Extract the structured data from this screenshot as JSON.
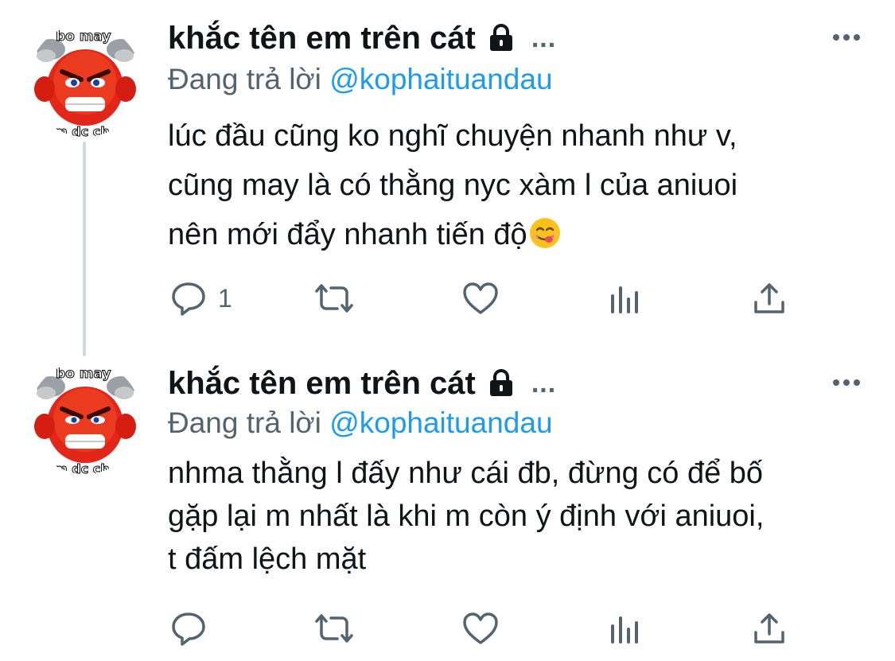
{
  "tweets": [
    {
      "author": "khắc tên em trên cát",
      "ellipsis": "...",
      "reply_prefix": "Đang trả lời",
      "reply_to": "@kophaituandau",
      "text": "lúc đầu cũng ko nghĩ chuyện nhanh như v,\ncũng may là có thằng nyc xàm l của aniuoi\nnên mới đẩy nhanh tiến độ",
      "emoji": "face-savoring-food-emoji",
      "avatar_caption_top": "bo may",
      "avatar_caption_bottom": "m dc ch",
      "reply_count": "1"
    },
    {
      "author": "khắc tên em trên cát",
      "ellipsis": "...",
      "reply_prefix": "Đang trả lời",
      "reply_to": "@kophaituandau",
      "text": "nhma thằng l đấy như cái đb, đừng có để bố\ngặp lại m nhất là khi m còn ý định với aniuoi,\nt đấm lệch mặt",
      "avatar_caption_top": "bo may",
      "avatar_caption_bottom": "m dc ch",
      "reply_count": ""
    }
  ],
  "icons": [
    "more-icon",
    "lock-icon",
    "reply-icon",
    "retweet-icon",
    "like-icon",
    "views-icon",
    "share-icon"
  ],
  "colors": {
    "text": "#0f1419",
    "secondary": "#536471",
    "mention": "#1d9bf0",
    "thread_line": "#cfd9de"
  }
}
